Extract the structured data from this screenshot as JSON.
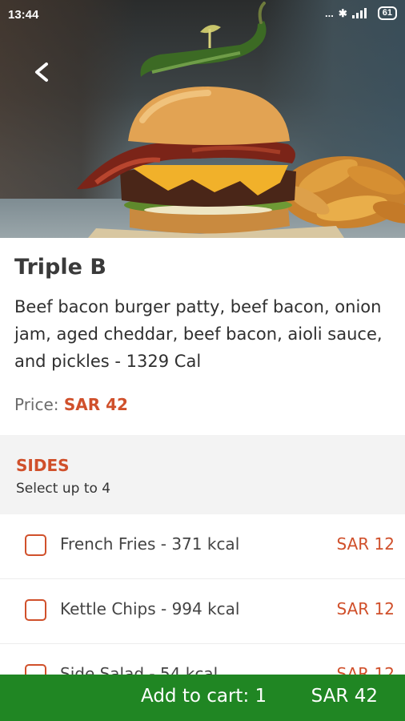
{
  "status_bar": {
    "time": "13:44",
    "signal_text": "...",
    "battery": "61"
  },
  "hero": {
    "back_icon": "chevron-left-icon",
    "image": "burger-photo"
  },
  "item": {
    "name": "Triple B",
    "description": "Beef bacon burger patty, beef bacon, onion jam, aged cheddar, beef bacon, aioli sauce, and pickles - 1329 Cal",
    "price_label": "Price:",
    "price_value": "SAR 42"
  },
  "sides": {
    "title": "SIDES",
    "subtitle": "Select up to 4",
    "options": [
      {
        "label": "French Fries - 371 kcal",
        "price": "SAR 12",
        "checked": false
      },
      {
        "label": "Kettle Chips - 994 kcal",
        "price": "SAR 12",
        "checked": false
      },
      {
        "label": "Side Salad - 54 kcal",
        "price": "SAR 12",
        "checked": false
      }
    ]
  },
  "cart": {
    "label": "Add to cart: 1",
    "total": "SAR 42"
  },
  "colors": {
    "accent": "#d0502b",
    "cart_bar": "#208623"
  }
}
